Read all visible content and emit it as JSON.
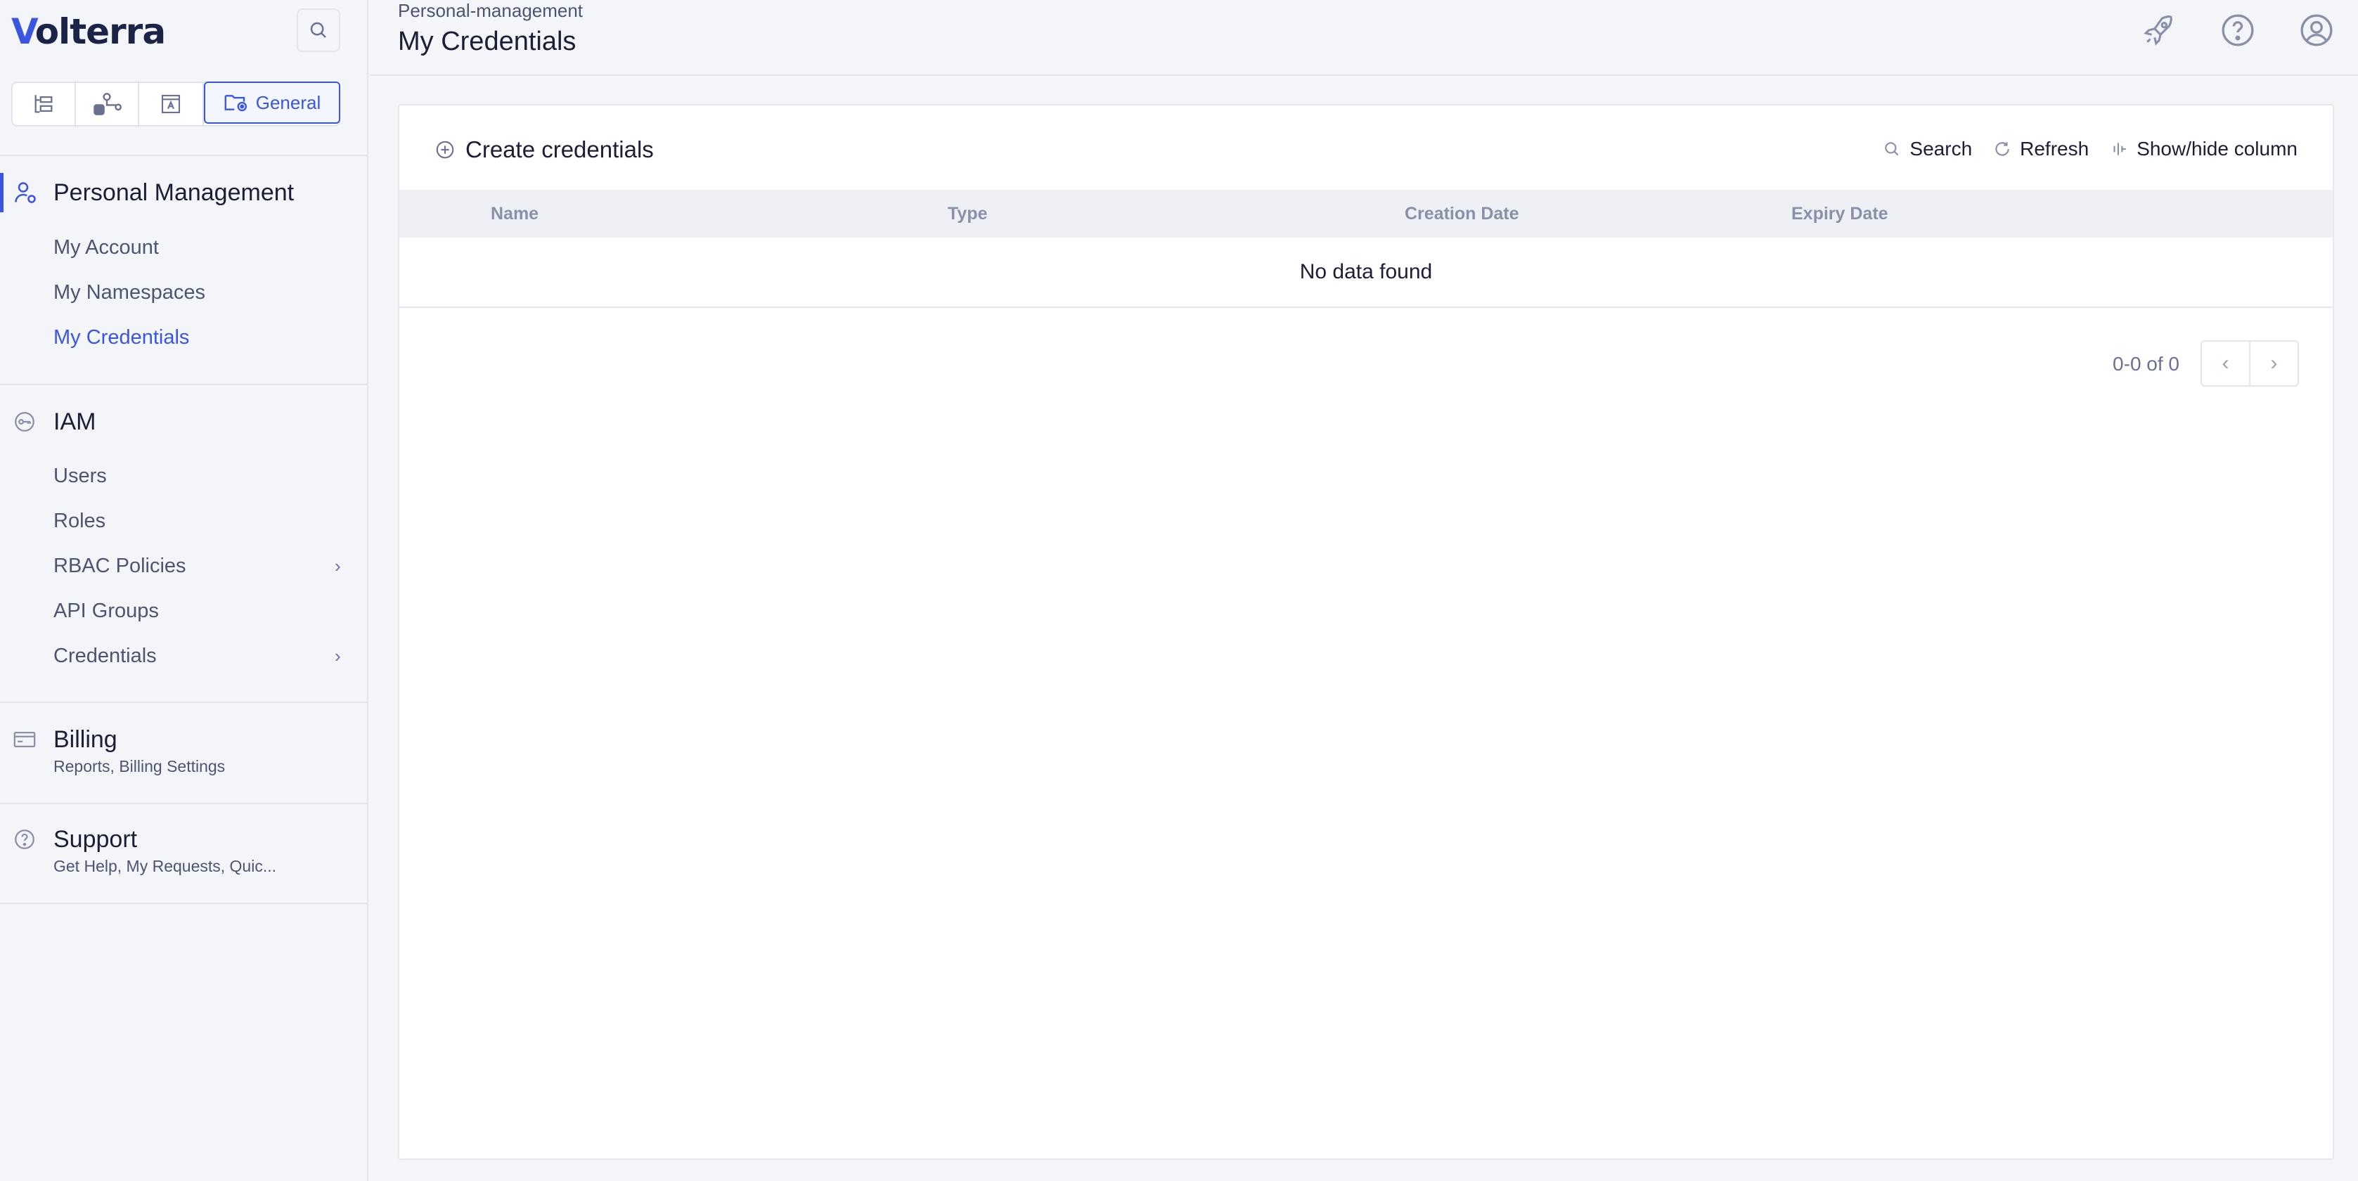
{
  "brand": {
    "name": "olterra",
    "mark": "V"
  },
  "sidebar": {
    "tabs": [
      {
        "icon": "tree-list-icon"
      },
      {
        "icon": "nodes-lock-icon"
      },
      {
        "icon": "app-window-icon"
      },
      {
        "icon": "folder-gear-icon",
        "label": "General"
      }
    ],
    "sections": {
      "personal": {
        "title": "Personal Management",
        "items": [
          "My Account",
          "My Namespaces",
          "My Credentials"
        ],
        "active_item": "My Credentials"
      },
      "iam": {
        "title": "IAM",
        "items": [
          "Users",
          "Roles",
          "RBAC Policies",
          "API Groups",
          "Credentials"
        ]
      },
      "billing": {
        "title": "Billing",
        "subtitle": "Reports, Billing Settings"
      },
      "support": {
        "title": "Support",
        "subtitle": "Get Help, My Requests, Quic..."
      }
    }
  },
  "header": {
    "breadcrumb": "Personal-management",
    "title": "My Credentials",
    "icons": [
      "rocket-icon",
      "help-icon",
      "user-icon"
    ]
  },
  "main": {
    "create_label": "Create credentials",
    "toolbar": {
      "search": "Search",
      "refresh": "Refresh",
      "columns": "Show/hide column"
    },
    "table": {
      "columns": [
        "Name",
        "Type",
        "Creation Date",
        "Expiry Date"
      ],
      "empty_text": "No data found"
    },
    "pagination": {
      "range": "0-0 of 0",
      "prev": "‹",
      "next": "›"
    }
  },
  "colors": {
    "accent": "#3a56e0",
    "text": "#1a1f36",
    "muted": "#4d5470",
    "bg": "#f4f5f9"
  }
}
